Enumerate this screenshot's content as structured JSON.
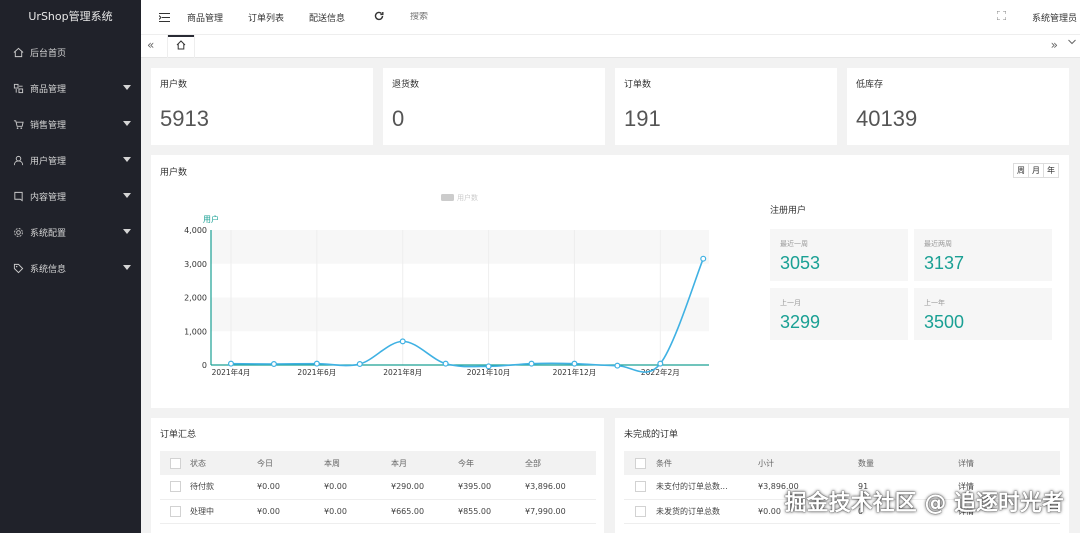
{
  "sidebar": {
    "brand": "UrShop管理系统",
    "items": [
      {
        "label": "后台首页",
        "icon": "home-icon",
        "expandable": false
      },
      {
        "label": "商品管理",
        "icon": "goods-icon",
        "expandable": true
      },
      {
        "label": "销售管理",
        "icon": "cart-icon",
        "expandable": true
      },
      {
        "label": "用户管理",
        "icon": "user-icon",
        "expandable": true
      },
      {
        "label": "内容管理",
        "icon": "content-icon",
        "expandable": true
      },
      {
        "label": "系统配置",
        "icon": "gear-icon",
        "expandable": true
      },
      {
        "label": "系统信息",
        "icon": "tag-icon",
        "expandable": true
      }
    ]
  },
  "header": {
    "nav": [
      "商品管理",
      "订单列表",
      "配送信息"
    ],
    "search_placeholder": "搜索",
    "admin": "系统管理员"
  },
  "stats": [
    {
      "title": "用户数",
      "value": "5913"
    },
    {
      "title": "退货数",
      "value": "0"
    },
    {
      "title": "订单数",
      "value": "191"
    },
    {
      "title": "低库存",
      "value": "40139"
    }
  ],
  "user_panel": {
    "title": "用户数",
    "range_buttons": [
      "周",
      "月",
      "年"
    ],
    "reg_title": "注册用户",
    "reg_stats": [
      {
        "label": "最近一周",
        "value": "3053"
      },
      {
        "label": "最近两周",
        "value": "3137"
      },
      {
        "label": "上一月",
        "value": "3299"
      },
      {
        "label": "上一年",
        "value": "3500"
      }
    ]
  },
  "chart_data": {
    "type": "line",
    "legend": "用户数",
    "ylabel": "用户",
    "ylim": [
      0,
      4000
    ],
    "yticks": [
      "4,000",
      "3,000",
      "2,000",
      "1,000",
      "0"
    ],
    "xtick_labels": [
      "2021年4月",
      "2021年6月",
      "2021年8月",
      "2021年10月",
      "2021年12月",
      "2022年2月"
    ],
    "series": [
      {
        "name": "用户数",
        "x": [
          "2021-04",
          "2021-05",
          "2021-06",
          "2021-07",
          "2021-08",
          "2021-09",
          "2021-10",
          "2021-11",
          "2021-12",
          "2022-01",
          "2022-02",
          "2022-03"
        ],
        "values": [
          40,
          30,
          40,
          30,
          700,
          40,
          -40,
          40,
          40,
          -20,
          40,
          3150
        ]
      }
    ],
    "color": "#3fb1e3"
  },
  "orders": {
    "title": "订单汇总",
    "headers": [
      "状态",
      "今日",
      "本周",
      "本月",
      "今年",
      "全部"
    ],
    "rows": [
      [
        "待付款",
        "¥0.00",
        "¥0.00",
        "¥290.00",
        "¥395.00",
        "¥3,896.00"
      ],
      [
        "处理中",
        "¥0.00",
        "¥0.00",
        "¥665.00",
        "¥855.00",
        "¥7,990.00"
      ]
    ]
  },
  "incomplete": {
    "title": "未完成的订单",
    "headers": [
      "条件",
      "小计",
      "数量",
      "详情"
    ],
    "rows": [
      [
        "未支付的订单总数...",
        "¥3,896.00",
        "91",
        "详情"
      ],
      [
        "未发货的订单总数",
        "¥0.00",
        "0",
        "详情"
      ]
    ]
  },
  "watermark": "掘金技术社区 @ 追逐时光者"
}
